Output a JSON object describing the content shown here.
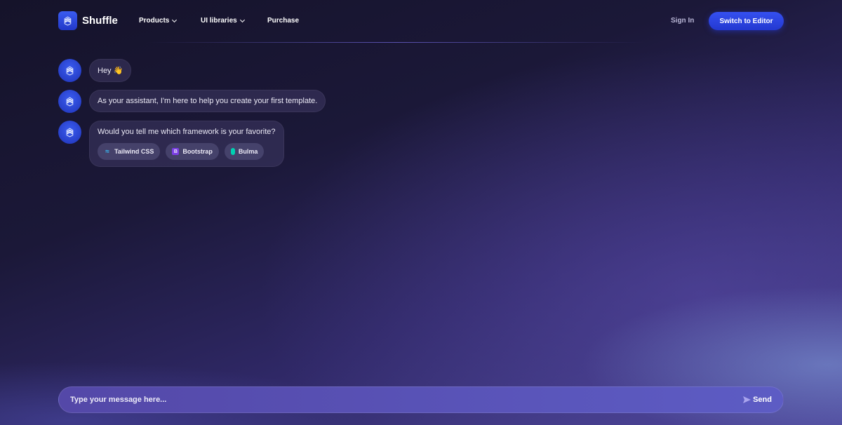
{
  "nav": {
    "brand": "Shuffle",
    "products": "Products",
    "ui_libraries": "UI libraries",
    "purchase": "Purchase",
    "sign_in": "Sign In",
    "switch_editor": "Switch to Editor"
  },
  "messages": [
    {
      "text": "Hey 👋"
    },
    {
      "text": "As your assistant, I'm here to help you create your first template."
    },
    {
      "text": "Would you tell me which framework is your favorite?",
      "options": [
        {
          "label": "Tailwind CSS",
          "icon": "tailwind-icon"
        },
        {
          "label": "Bootstrap",
          "icon": "bootstrap-icon"
        },
        {
          "label": "Bulma",
          "icon": "bulma-icon"
        }
      ]
    }
  ],
  "composer": {
    "placeholder": "Type your message here...",
    "send": "Send"
  },
  "colors": {
    "accent": "#2f48e0",
    "bootstrap": "#7b3fe4",
    "bulma": "#00d1b2",
    "tailwind": "#38bdf8"
  }
}
